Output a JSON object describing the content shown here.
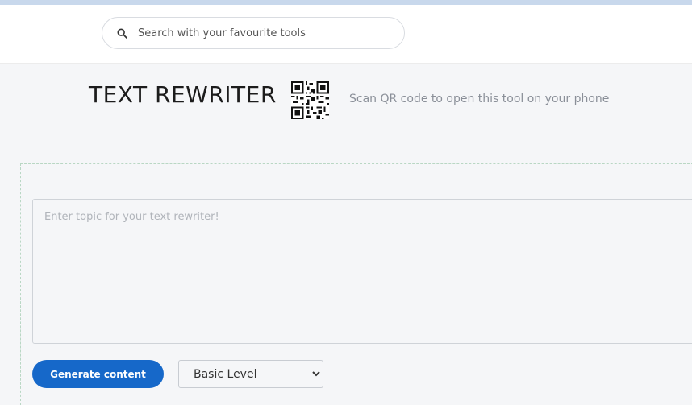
{
  "search": {
    "placeholder": "Search with your favourite tools",
    "icon": "search-icon"
  },
  "tool": {
    "title": "TEXT REWRITER",
    "qr_caption": "Scan QR code to open this tool on your phone",
    "qr_icon": "qr-code-icon"
  },
  "editor": {
    "placeholder": "Enter topic for your text rewriter!"
  },
  "actions": {
    "generate_label": "Generate content",
    "level_selected": "Basic Level"
  },
  "colors": {
    "accent": "#1668c9",
    "page_bg": "#f5f6f8"
  }
}
